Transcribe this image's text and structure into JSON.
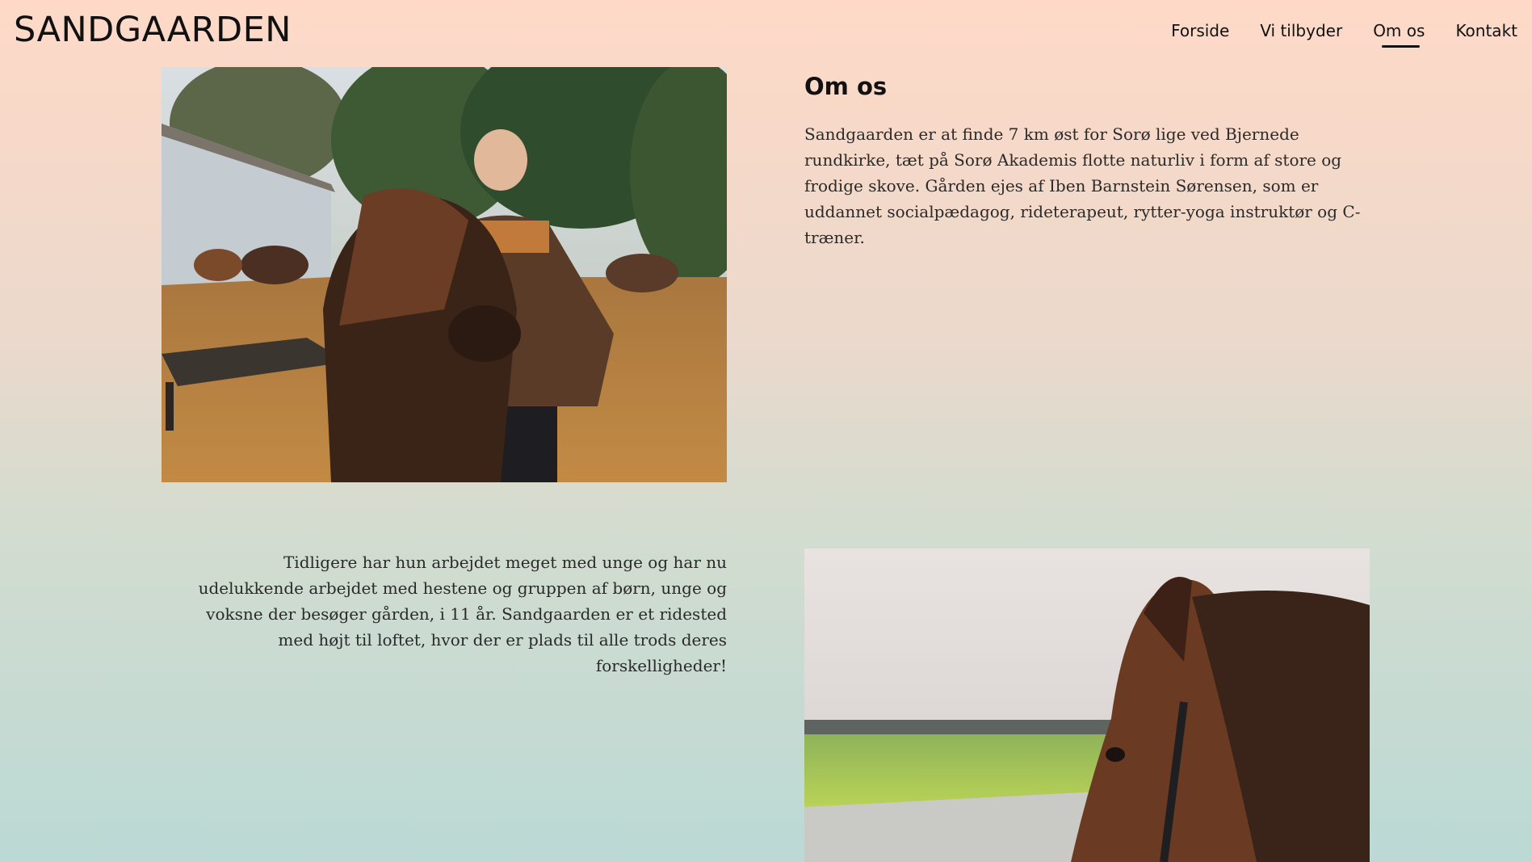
{
  "header": {
    "logo": "SANDGAARDEN",
    "nav": [
      {
        "label": "Forside"
      },
      {
        "label": "Vi tilbyder"
      },
      {
        "label": "Om os"
      },
      {
        "label": "Kontakt"
      }
    ]
  },
  "main": {
    "title": "Om os",
    "paragraph1": "Sandgaarden er at finde 7 km øst for Sorø lige ved Bjernede rundkirke, tæt på Sorø Akademis flotte naturliv i form af store og frodige skove. Gården ejes af Iben Barnstein Sørensen, som er uddannet socialpædagog, rideterapeut, rytter-yoga instruktør og C-træner.",
    "paragraph2": "Tidligere har hun arbejdet meget med unge og har nu udelukkende arbejdet med hestene og gruppen af børn, unge og voksne der besøger gården, i 11 år. Sandgaarden er et ridested med højt til loftet, hvor der er plads til alle trods deres forskelligheder!"
  }
}
